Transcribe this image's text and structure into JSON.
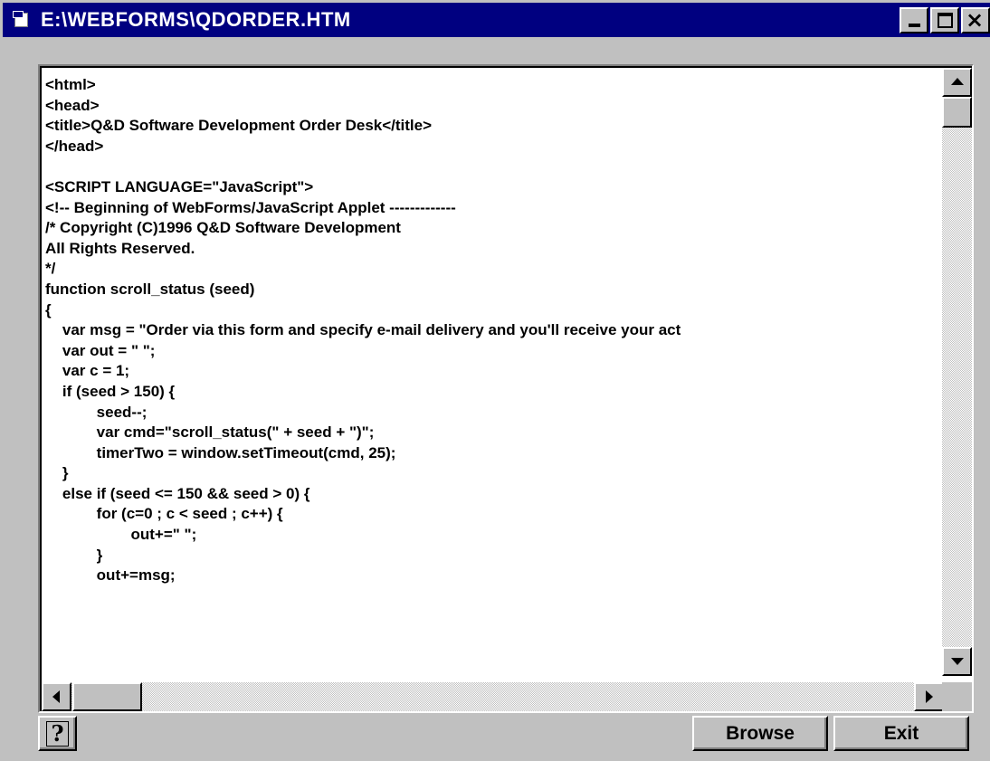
{
  "window": {
    "title": "E:\\WEBFORMS\\QDORDER.HTM"
  },
  "editor": {
    "lines": [
      "<html>",
      "<head>",
      "<title>Q&D Software Development Order Desk</title>",
      "</head>",
      "",
      "<SCRIPT LANGUAGE=\"JavaScript\">",
      "<!-- Beginning of WebForms/JavaScript Applet -------------",
      "/* Copyright (C)1996 Q&D Software Development",
      "All Rights Reserved.",
      "*/",
      "function scroll_status (seed)",
      "{",
      "    var msg = \"Order via this form and specify e-mail delivery and you'll receive your act",
      "    var out = \" \";",
      "    var c = 1;",
      "    if (seed > 150) {",
      "            seed--;",
      "            var cmd=\"scroll_status(\" + seed + \")\";",
      "            timerTwo = window.setTimeout(cmd, 25);",
      "    }",
      "    else if (seed <= 150 && seed > 0) {",
      "            for (c=0 ; c < seed ; c++) {",
      "                    out+=\" \";",
      "            }",
      "            out+=msg;"
    ]
  },
  "buttons": {
    "help_label": "?",
    "browse_label": "Browse",
    "exit_label": "Exit"
  },
  "icons": {
    "app": "document-icon",
    "minimize": "minimize-icon",
    "maximize": "maximize-icon",
    "close": "close-icon",
    "help": "help-icon"
  },
  "colors": {
    "titlebar": "#000080",
    "face": "#c0c0c0",
    "editor_bg": "#ffffff"
  }
}
